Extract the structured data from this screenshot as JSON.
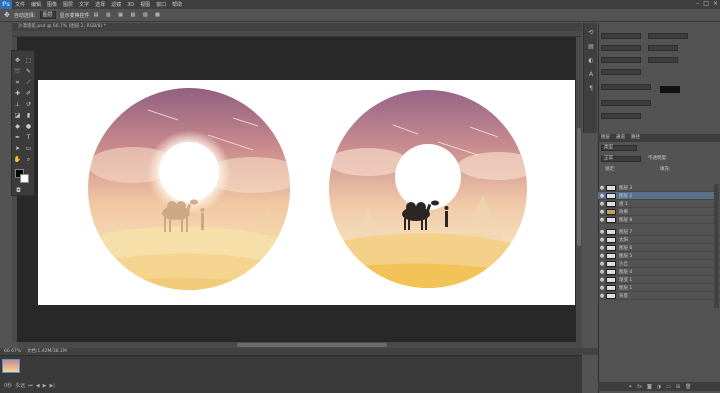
{
  "app": {
    "logo": "Ps",
    "title": "Adobe Photoshop"
  },
  "menu": [
    "文件",
    "编辑",
    "图像",
    "图层",
    "文字",
    "选择",
    "滤镜",
    "3D",
    "视图",
    "窗口",
    "帮助"
  ],
  "window_controls": {
    "minimize": "–",
    "maximize": "□",
    "close": "×"
  },
  "options_bar": {
    "tool_icon": "move-tool-icon",
    "items": [
      "自动选择:",
      "图层",
      "显示变换控件"
    ]
  },
  "document_tab": {
    "label": "沙漠骆驼.psd @ 66.7% (图层 2, RGB/8) *"
  },
  "status": {
    "zoom": "66.67%",
    "doc_info": "文档:1.42M/38.1M"
  },
  "timeline": {
    "frame_time": "0秒",
    "loop": "永远"
  },
  "layers_panel": {
    "tabs": [
      "图层",
      "通道",
      "路径"
    ],
    "filter_label": "类型",
    "blend_mode": "正常",
    "opacity_label": "不透明度:",
    "fill_label": "填充:",
    "lock_label": "锁定:",
    "layers": [
      {
        "name": "图层 3",
        "visible": true,
        "selected": false
      },
      {
        "name": "图层 2",
        "visible": true,
        "selected": true
      },
      {
        "name": "组 1",
        "visible": true,
        "selected": false
      },
      {
        "name": "效果",
        "visible": true,
        "selected": false
      },
      {
        "name": "图层 8",
        "visible": true,
        "selected": false
      },
      {
        "name": "图层 7",
        "visible": true,
        "selected": false
      },
      {
        "name": "太阳",
        "visible": true,
        "selected": false
      },
      {
        "name": "图层 6",
        "visible": true,
        "selected": false
      },
      {
        "name": "图层 5",
        "visible": true,
        "selected": false
      },
      {
        "name": "沙丘",
        "visible": true,
        "selected": false
      },
      {
        "name": "图层 4",
        "visible": true,
        "selected": false
      },
      {
        "name": "渐变 1",
        "visible": true,
        "selected": false
      },
      {
        "name": "图层 1",
        "visible": true,
        "selected": false
      },
      {
        "name": "背景",
        "visible": true,
        "selected": false
      }
    ]
  },
  "colors": {
    "foreground": "#000000",
    "background": "#ffffff",
    "selection": "#5a6f8a"
  }
}
